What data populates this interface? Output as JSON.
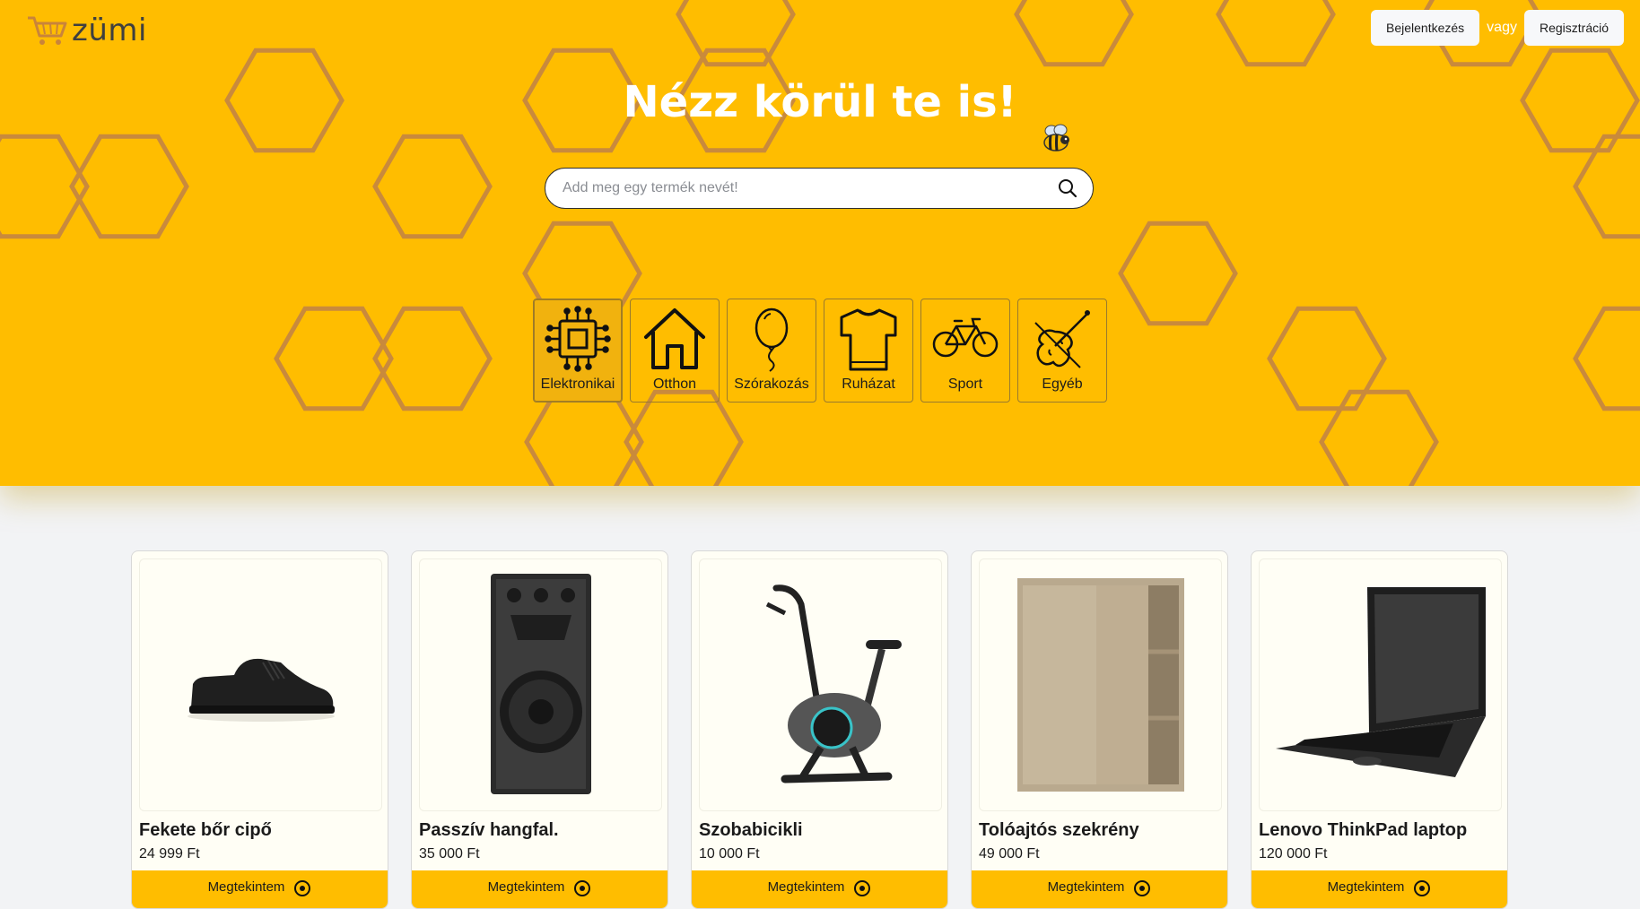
{
  "brand": {
    "name": "zümi"
  },
  "auth": {
    "login": "Bejelentkezés",
    "or": "vagy",
    "register": "Regisztráció"
  },
  "hero": {
    "title": "Nézz körül te is!"
  },
  "search": {
    "placeholder": "Add meg egy termék nevét!"
  },
  "categories": [
    {
      "label": "Elektronikai",
      "icon": "chip-icon"
    },
    {
      "label": "Otthon",
      "icon": "house-icon"
    },
    {
      "label": "Szórakozás",
      "icon": "balloon-icon"
    },
    {
      "label": "Ruházat",
      "icon": "tshirt-icon"
    },
    {
      "label": "Sport",
      "icon": "bicycle-icon"
    },
    {
      "label": "Egyéb",
      "icon": "violin-icon"
    }
  ],
  "products": [
    {
      "name": "Fekete bőr cipő",
      "price": "24 999 Ft",
      "button": "Megtekintem",
      "image": "shoe-image"
    },
    {
      "name": "Passzív hangfal.",
      "price": "35 000 Ft",
      "button": "Megtekintem",
      "image": "speaker-image"
    },
    {
      "name": "Szobabicikli",
      "price": "10 000 Ft",
      "button": "Megtekintem",
      "image": "exercise-bike-image"
    },
    {
      "name": "Tolóajtós szekrény",
      "price": "49 000 Ft",
      "button": "Megtekintem",
      "image": "wardrobe-image"
    },
    {
      "name": "Lenovo ThinkPad laptop",
      "price": "120 000 Ft",
      "button": "Megtekintem",
      "image": "laptop-image"
    }
  ],
  "colors": {
    "accent": "#ffbd00",
    "hexagon": "#c98a3c",
    "text": "#1b1b1b",
    "page": "#f2f3f5"
  }
}
